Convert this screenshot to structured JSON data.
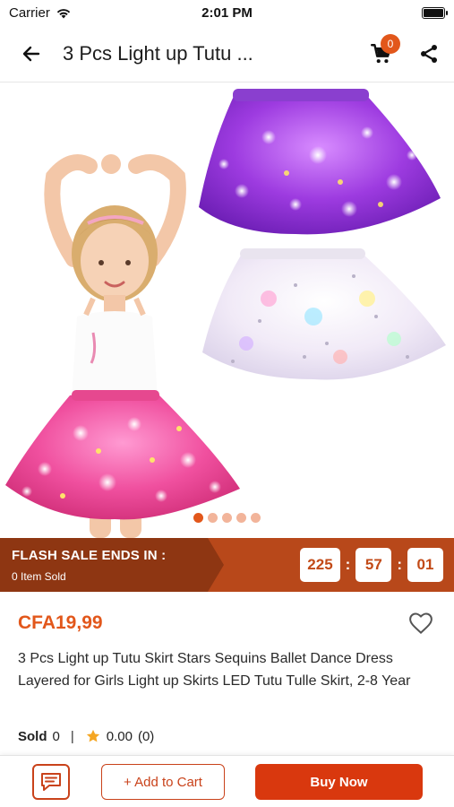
{
  "status_bar": {
    "carrier": "Carrier",
    "time": "2:01 PM"
  },
  "header": {
    "title": "3 Pcs Light up Tutu ...",
    "cart_count": "0",
    "icons": [
      "back-arrow-icon",
      "cart-icon",
      "share-icon"
    ]
  },
  "gallery": {
    "image_count": 5,
    "active_index": 0
  },
  "flash_sale": {
    "title": "FLASH SALE ENDS IN :",
    "sold_text": "0 Item Sold",
    "timer": [
      "225",
      "57",
      "01"
    ]
  },
  "product": {
    "price": "CFA19,99",
    "description": "3 Pcs Light up Tutu Skirt Stars Sequins Ballet Dance Dress Layered for Girls Light up Skirts LED Tutu Tulle Skirt, 2-8 Year",
    "sold_label": "Sold",
    "sold_count": "0",
    "rating": "0.00",
    "review_count": "(0)"
  },
  "actions": {
    "add_to_cart": "+ Add to Cart",
    "buy_now": "Buy Now"
  },
  "colors": {
    "accent": "#e2571b",
    "flash_dark": "#8e3612",
    "flash_bar": "#b8481a",
    "buy_button": "#d9380e",
    "star": "#f5a623"
  }
}
